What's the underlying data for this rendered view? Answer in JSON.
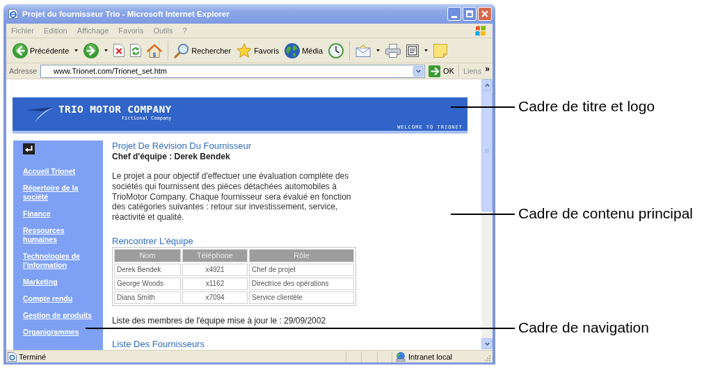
{
  "window": {
    "title": "Projet du fournisseur Trio - Microsoft Internet Explorer",
    "active": false
  },
  "menu_bar": [
    "Fichier",
    "Edition",
    "Affichage",
    "Favoris",
    "Outils",
    "?"
  ],
  "toolbar": [
    {
      "kind": "back",
      "label": "Précédente",
      "dropdown": true
    },
    {
      "kind": "forward",
      "dropdown": true
    },
    {
      "kind": "stop",
      "dropdown": false
    },
    {
      "kind": "refresh",
      "dropdown": false
    },
    {
      "kind": "home",
      "dropdown": false
    },
    {
      "kind": "separator"
    },
    {
      "kind": "search",
      "label": "Rechercher",
      "dropdown": false
    },
    {
      "kind": "favorites",
      "label": "Favoris",
      "dropdown": false
    },
    {
      "kind": "media",
      "label": "Média",
      "dropdown": false
    },
    {
      "kind": "history",
      "dropdown": false
    },
    {
      "kind": "separator"
    },
    {
      "kind": "mail",
      "dropdown": true
    },
    {
      "kind": "print",
      "dropdown": false
    },
    {
      "kind": "edit",
      "dropdown": true
    },
    {
      "kind": "notes",
      "dropdown": false
    }
  ],
  "address_bar": {
    "label": "Adresse",
    "value": "www.Trionet.com/Trionet_set.htm",
    "go_label": "OK",
    "links_label": "Liens",
    "more": "»"
  },
  "page": {
    "banner": {
      "company": "TRIO MOTOR COMPANY",
      "tagline": "Fictional Company",
      "welcome": "WELCOME TO TRIONET"
    },
    "navigation": {
      "items": [
        "Accueil Trionet",
        "Répertoire de la société",
        "Finance",
        "Ressources humaines",
        "Technologies de l'information",
        "Marketing",
        "Compte rendu",
        "Gestion de produits",
        "Organigrammes"
      ]
    },
    "content": {
      "title": "Projet De Révision Du Fournisseur",
      "lead": "Chef d'équipe : Derek Bendek",
      "description": "Le projet a pour objectif d'effectuer une évaluation complète des sociétés qui fournissent des pièces détachées automobiles à TrioMotor Company. Chaque fournisseur sera évalué en fonction des catégories suivantes : retour sur investissement, service, réactivité et qualité.",
      "team_heading": "Rencontrer L'équipe",
      "team_table": {
        "columns": [
          "Nom",
          "Téléphone",
          "Rôle"
        ],
        "rows": [
          [
            "Derek Bendek",
            "x4921",
            "Chef de projet"
          ],
          [
            "George Woods",
            "x1162",
            "Directrice des opérations"
          ],
          [
            "Diana Smith",
            "x7094",
            "Service clientèle"
          ]
        ]
      },
      "updated_note": "Liste des membres de l'équipe mise à jour le : 29/09/2002",
      "suppliers_heading": "Liste Des Fournisseurs"
    }
  },
  "status_bar": {
    "status": "Terminé",
    "zone": "Intranet local"
  },
  "callouts": [
    {
      "kind": "banner",
      "label": "Cadre de titre et logo"
    },
    {
      "kind": "content",
      "label": "Cadre de contenu principal"
    },
    {
      "kind": "navigation",
      "label": "Cadre de navigation"
    }
  ]
}
